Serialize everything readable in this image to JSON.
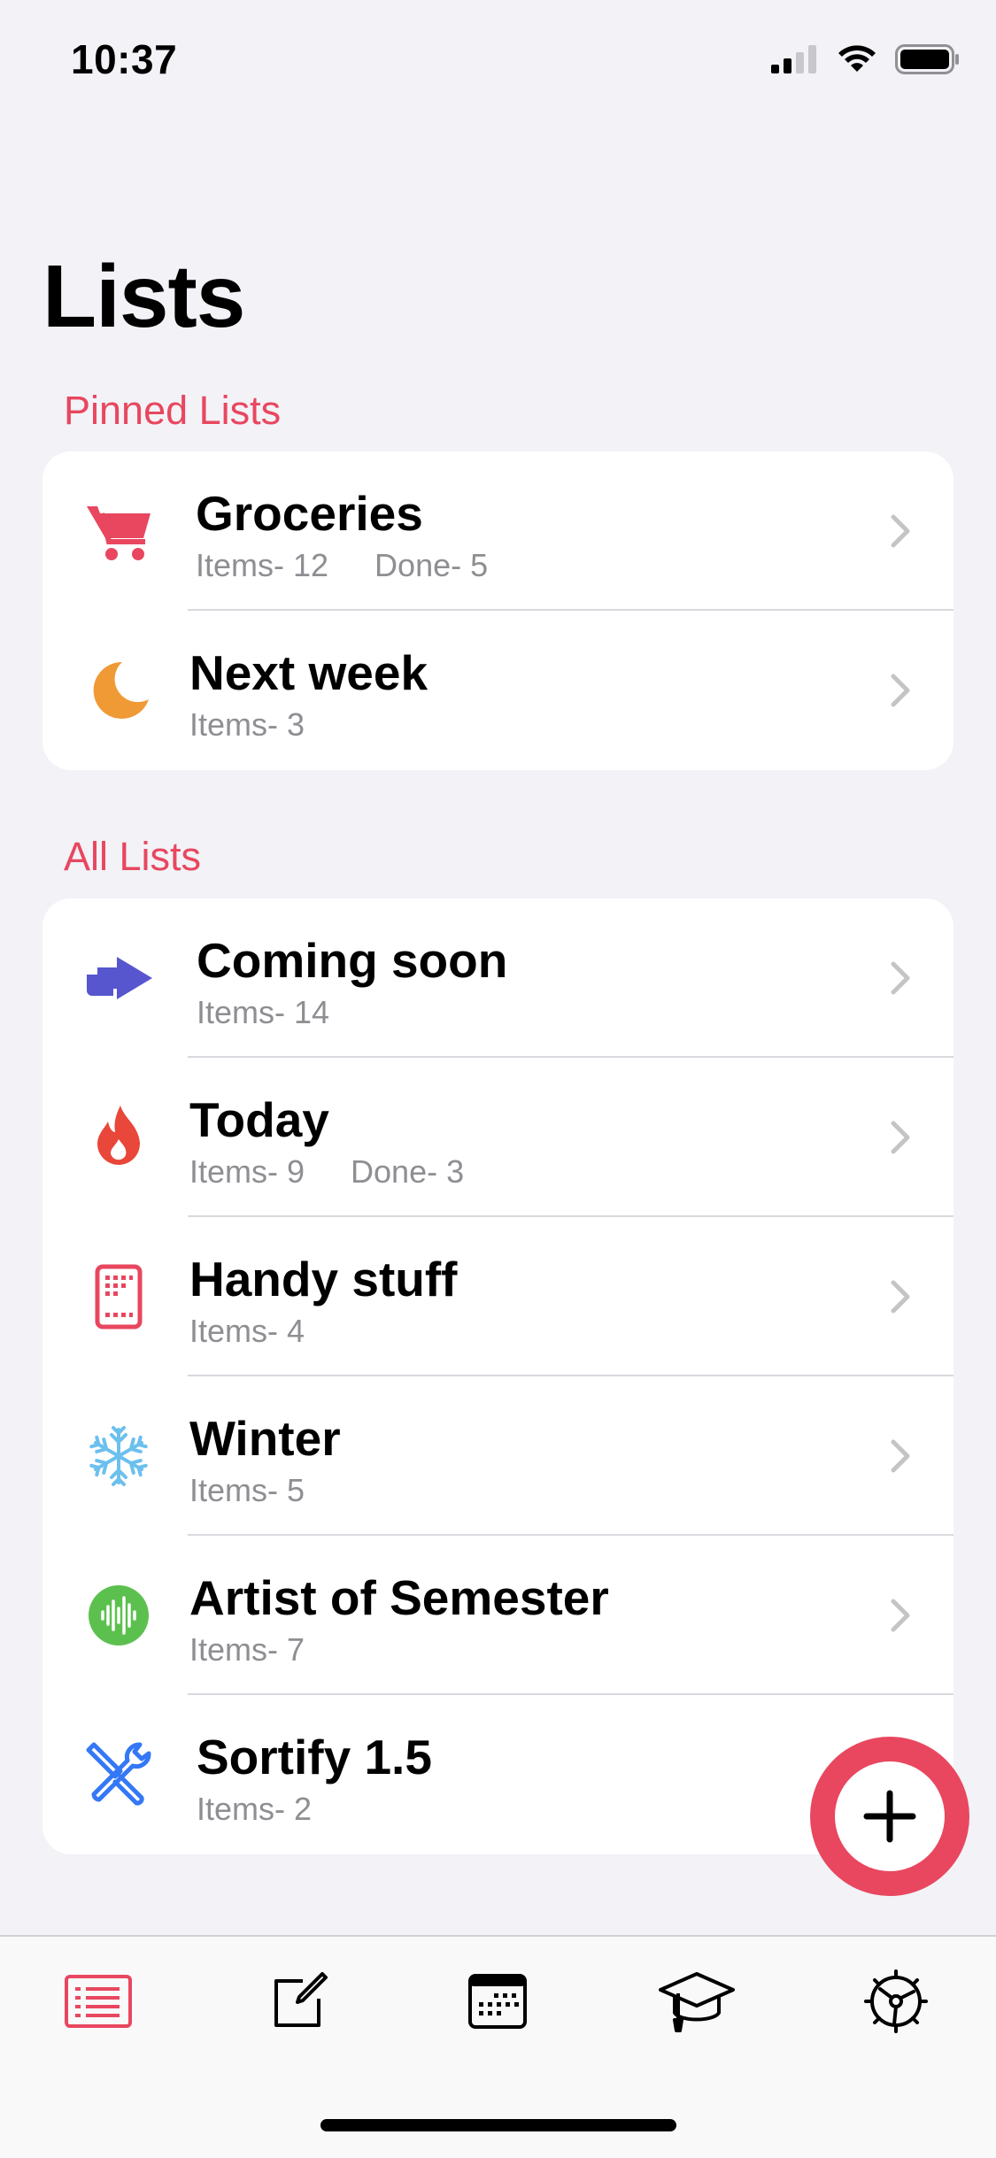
{
  "status": {
    "time": "10:37"
  },
  "page_title": "Lists",
  "pinned": {
    "header": "Pinned Lists",
    "items": [
      {
        "name": "Groceries",
        "items_text": "Items- 12",
        "done_text": "Done- 5",
        "icon": "cart-icon",
        "color": "#e8475f"
      },
      {
        "name": "Next week",
        "items_text": "Items- 3",
        "icon": "moon-icon",
        "color": "#f09a36"
      }
    ]
  },
  "all": {
    "header": "All Lists",
    "items": [
      {
        "name": "Coming soon",
        "items_text": "Items- 14",
        "icon": "arrows-swap-icon",
        "color": "#5756ce"
      },
      {
        "name": "Today",
        "items_text": "Items- 9",
        "done_text": "Done- 3",
        "icon": "flame-icon",
        "color": "#e8473a"
      },
      {
        "name": "Handy stuff",
        "items_text": "Items- 4",
        "icon": "calculator-icon",
        "color": "#e8475f"
      },
      {
        "name": "Winter",
        "items_text": "Items- 5",
        "icon": "snowflake-icon",
        "color": "#6cc0ee"
      },
      {
        "name": "Artist of Semester",
        "items_text": "Items- 7",
        "icon": "waveform-icon",
        "color": "#5cc04f"
      },
      {
        "name": "Sortify 1.5",
        "items_text": "Items- 2",
        "icon": "tools-icon",
        "color": "#3478f6"
      }
    ]
  },
  "tabs": [
    {
      "icon": "list-icon",
      "active": true
    },
    {
      "icon": "compose-icon"
    },
    {
      "icon": "calendar-icon"
    },
    {
      "icon": "graduation-cap-icon"
    },
    {
      "icon": "settings-wheel-icon"
    }
  ],
  "accent": "#e8475f"
}
